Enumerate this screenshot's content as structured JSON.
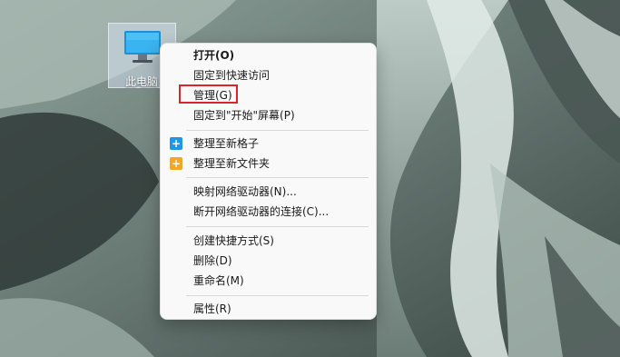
{
  "desktop": {
    "icon_label": "此电脑"
  },
  "context_menu": {
    "items": [
      {
        "label": "打开(O)",
        "bold": true
      },
      {
        "label": "固定到快速访问"
      },
      {
        "label": "管理(G)",
        "highlighted": true
      },
      {
        "label": "固定到\"开始\"屏幕(P)"
      },
      {
        "label": "整理至新格子",
        "icon": "plus-blue-icon"
      },
      {
        "label": "整理至新文件夹",
        "icon": "plus-folder-icon"
      },
      {
        "label": "映射网络驱动器(N)..."
      },
      {
        "label": "断开网络驱动器的连接(C)..."
      },
      {
        "label": "创建快捷方式(S)"
      },
      {
        "label": "删除(D)"
      },
      {
        "label": "重命名(M)"
      },
      {
        "label": "属性(R)"
      }
    ]
  },
  "colors": {
    "highlight_border": "#d9262e",
    "blue_icon": "#1f96e8",
    "folder_icon": "#f5a623"
  }
}
